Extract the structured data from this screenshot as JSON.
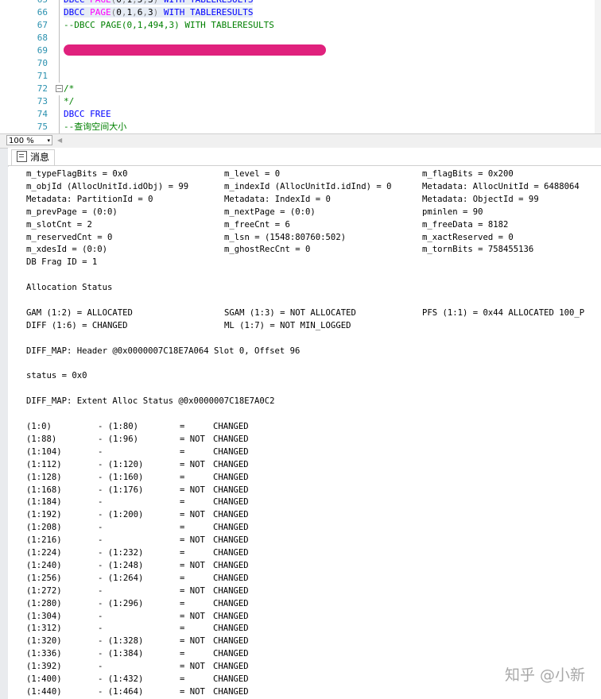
{
  "editor": {
    "lines": [
      {
        "num": "65",
        "parts": [
          {
            "t": "DBCC ",
            "c": "kw"
          },
          {
            "t": "PAGE",
            "c": "fn"
          },
          {
            "t": "(",
            "c": "gray"
          },
          {
            "t": "0",
            "c": "txt"
          },
          {
            "t": ",",
            "c": "gray"
          },
          {
            "t": "1",
            "c": "txt"
          },
          {
            "t": ",",
            "c": "gray"
          },
          {
            "t": "5",
            "c": "txt"
          },
          {
            "t": ",",
            "c": "gray"
          },
          {
            "t": "3",
            "c": "txt"
          },
          {
            "t": ")",
            "c": "gray"
          },
          {
            "t": " WITH TABLERESULTS",
            "c": "kw"
          }
        ],
        "hl": true
      },
      {
        "num": "66",
        "parts": [
          {
            "t": "DBCC ",
            "c": "kw"
          },
          {
            "t": "PAGE",
            "c": "fn"
          },
          {
            "t": "(",
            "c": "gray"
          },
          {
            "t": "0",
            "c": "txt"
          },
          {
            "t": ",",
            "c": "gray"
          },
          {
            "t": "1",
            "c": "txt"
          },
          {
            "t": ",",
            "c": "gray"
          },
          {
            "t": "6",
            "c": "txt"
          },
          {
            "t": ",",
            "c": "gray"
          },
          {
            "t": "3",
            "c": "txt"
          },
          {
            "t": ")",
            "c": "gray"
          },
          {
            "t": " WITH TABLERESULTS",
            "c": "kw"
          }
        ],
        "hl": true
      },
      {
        "num": "67",
        "parts": [
          {
            "t": "--DBCC PAGE(0,1,494,3) WITH TABLERESULTS",
            "c": "cm"
          }
        ]
      },
      {
        "num": "68",
        "parts": []
      },
      {
        "num": "69",
        "parts": []
      },
      {
        "num": "70",
        "parts": []
      },
      {
        "num": "71",
        "parts": []
      },
      {
        "num": "72",
        "parts": [
          {
            "t": "/*",
            "c": "cm"
          }
        ],
        "fold": "−"
      },
      {
        "num": "73",
        "parts": [
          {
            "t": "*/",
            "c": "cm"
          }
        ]
      },
      {
        "num": "74",
        "parts": [
          {
            "t": "DBCC FREE",
            "c": "kw"
          }
        ]
      },
      {
        "num": "75",
        "parts": [
          {
            "t": "--查询空间大小",
            "c": "cm"
          }
        ]
      }
    ]
  },
  "toolbar": {
    "zoom": "100 %",
    "zoom_arrow": "▾",
    "scroll_left": "◀"
  },
  "tabs": {
    "messages": "消息"
  },
  "header_rows": [
    [
      "m_typeFlagBits = 0x0",
      "m_level = 0",
      "m_flagBits = 0x200"
    ],
    [
      "m_objId (AllocUnitId.idObj) = 99",
      "m_indexId (AllocUnitId.idInd) = 0",
      "Metadata: AllocUnitId = 6488064"
    ],
    [
      "Metadata: PartitionId = 0",
      "Metadata: IndexId = 0",
      "Metadata: ObjectId = 99"
    ],
    [
      "m_prevPage = (0:0)",
      "m_nextPage = (0:0)",
      "pminlen = 90"
    ],
    [
      "m_slotCnt = 2",
      "m_freeCnt = 6",
      "m_freeData = 8182"
    ],
    [
      "m_reservedCnt = 0",
      "m_lsn = (1548:80760:502)",
      "m_xactReserved = 0"
    ],
    [
      "m_xdesId = (0:0)",
      "m_ghostRecCnt = 0",
      "m_tornBits = 758455136"
    ],
    [
      "DB Frag ID = 1",
      "",
      ""
    ]
  ],
  "allocation_status_label": "Allocation Status",
  "alloc_rows": [
    [
      "GAM (1:2) = ALLOCATED",
      "SGAM (1:3) = NOT ALLOCATED",
      "PFS (1:1) = 0x44 ALLOCATED 100_P"
    ],
    [
      "DIFF (1:6) = CHANGED",
      "ML (1:7) = NOT MIN_LOGGED",
      ""
    ]
  ],
  "diff_map_header": "DIFF_MAP: Header @0x0000007C18E7A064 Slot 0, Offset 96",
  "status_line": "status = 0x0",
  "diff_map_extent": "DIFF_MAP: Extent Alloc Status @0x0000007C18E7A0C2",
  "extent_rows": [
    [
      "(1:0)",
      "- (1:80)",
      "=",
      "CHANGED"
    ],
    [
      "(1:88)",
      "- (1:96)",
      "= NOT",
      "CHANGED"
    ],
    [
      "(1:104)",
      "-",
      "=",
      "CHANGED"
    ],
    [
      "(1:112)",
      "- (1:120)",
      "= NOT",
      "CHANGED"
    ],
    [
      "(1:128)",
      "- (1:160)",
      "=",
      "CHANGED"
    ],
    [
      "(1:168)",
      "- (1:176)",
      "= NOT",
      "CHANGED"
    ],
    [
      "(1:184)",
      "-",
      "=",
      "CHANGED"
    ],
    [
      "(1:192)",
      "- (1:200)",
      "= NOT",
      "CHANGED"
    ],
    [
      "(1:208)",
      "-",
      "=",
      "CHANGED"
    ],
    [
      "(1:216)",
      "-",
      "= NOT",
      "CHANGED"
    ],
    [
      "(1:224)",
      "- (1:232)",
      "=",
      "CHANGED"
    ],
    [
      "(1:240)",
      "- (1:248)",
      "= NOT",
      "CHANGED"
    ],
    [
      "(1:256)",
      "- (1:264)",
      "=",
      "CHANGED"
    ],
    [
      "(1:272)",
      "-",
      "= NOT",
      "CHANGED"
    ],
    [
      "(1:280)",
      "- (1:296)",
      "=",
      "CHANGED"
    ],
    [
      "(1:304)",
      "-",
      "= NOT",
      "CHANGED"
    ],
    [
      "(1:312)",
      "-",
      "=",
      "CHANGED"
    ],
    [
      "(1:320)",
      "- (1:328)",
      "= NOT",
      "CHANGED"
    ],
    [
      "(1:336)",
      "- (1:384)",
      "=",
      "CHANGED"
    ],
    [
      "(1:392)",
      "-",
      "= NOT",
      "CHANGED"
    ],
    [
      "(1:400)",
      "- (1:432)",
      "=",
      "CHANGED"
    ],
    [
      "(1:440)",
      "- (1:464)",
      "= NOT",
      "CHANGED"
    ]
  ],
  "watermark": "知乎 @小新",
  "colors": {
    "keyword": "#0000ff",
    "function": "#ff00ff",
    "comment": "#008000",
    "line_number": "#2b91af",
    "redaction": "#e0217d"
  }
}
